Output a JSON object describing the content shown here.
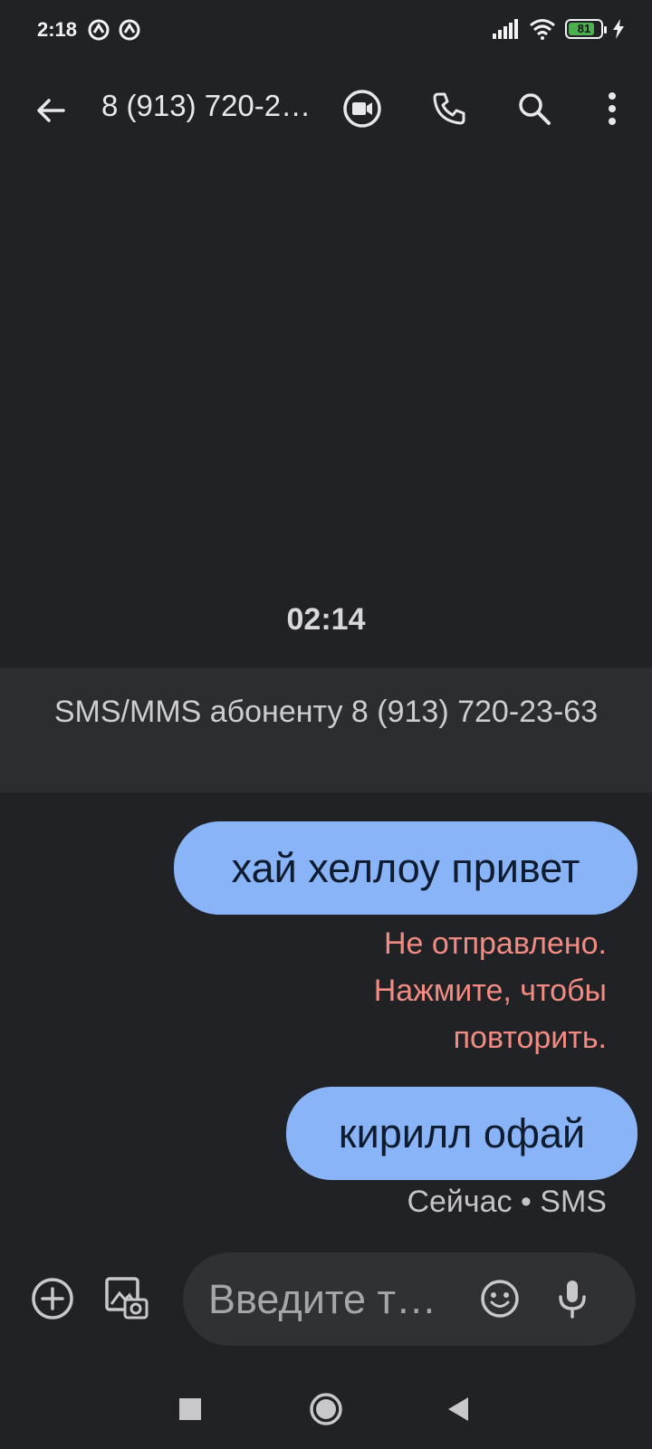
{
  "status_bar": {
    "time": "2:18",
    "battery_level": "81",
    "battery_fraction": 0.81,
    "left_icons": [
      "notification-icon",
      "notification-icon"
    ],
    "right_icons": [
      "signal-icon",
      "wifi-icon",
      "battery-icon",
      "charging-icon"
    ]
  },
  "app_bar": {
    "title": "8 (913) 720-2…",
    "icons": [
      "back-arrow-icon",
      "video-call-icon",
      "phone-icon",
      "search-icon",
      "more-vert-icon"
    ]
  },
  "conversation": {
    "timestamp": "02:14",
    "notice": "SMS/MMS абоненту 8 (913) 720-23-63",
    "messages": [
      {
        "text": "хай хеллоу привет",
        "status": "Не отправлено. Нажмите, чтобы повторить."
      },
      {
        "text": "кирилл офай",
        "status": "Сейчас • SMS"
      }
    ]
  },
  "composer": {
    "placeholder": "Введите т…",
    "icons": [
      "add-circle-icon",
      "gallery-icon",
      "emoji-icon",
      "mic-icon"
    ]
  },
  "nav_bar": {
    "icons": [
      "recents-square-icon",
      "home-circle-icon",
      "back-triangle-icon"
    ]
  },
  "colors": {
    "background": "#212226",
    "bubble": "#8ab4f8",
    "error": "#f28b82",
    "notice_bg": "#2c2d31",
    "input_bg": "#303135"
  }
}
